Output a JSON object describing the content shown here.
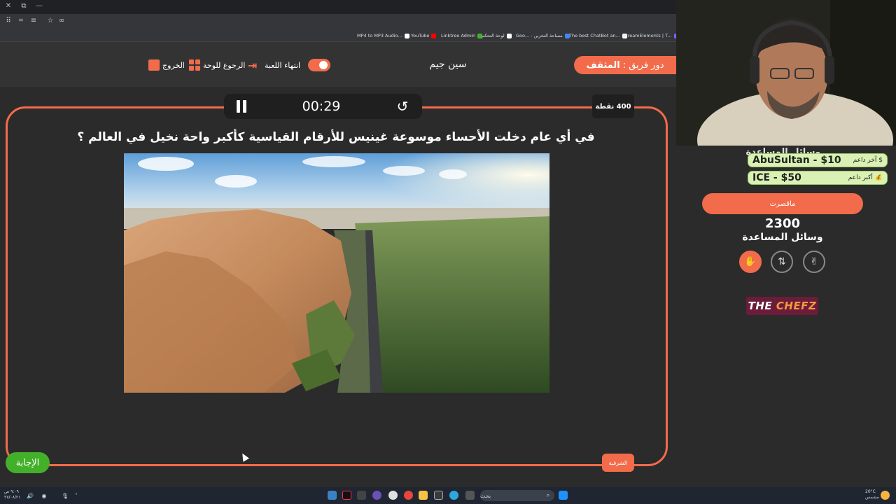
{
  "browser": {
    "bookmarks": [
      {
        "label": "MP4 to MP3 Audio...",
        "color": "#e53935"
      },
      {
        "label": "YouTube",
        "color": "#ff0000"
      },
      {
        "label": "Linktree Admin",
        "color": "#43b02a"
      },
      {
        "label": "لوحة التحكم",
        "color": "#ffffff"
      },
      {
        "label": "Goo... - مساحة التخزين",
        "color": "#4285f4"
      },
      {
        "label": "The best ChatBot an...",
        "color": "#ffffff"
      },
      {
        "label": "StreamElements | T...",
        "color": "#7b61ff"
      }
    ]
  },
  "header": {
    "team_label": "دور فريق :",
    "team_name": "المثقف",
    "player": "سين جيم",
    "end_game": "انتهاء اللعبة",
    "back_to_board": "الرجوع للوحة",
    "exit": "الخروج"
  },
  "game": {
    "timer": "00:29",
    "points": "400 نقطة",
    "question": "في أي عام دخلت الأحساء موسوعة غينيس للأرقام القياسية كأكبر واحة نخيل في العالم ؟",
    "answer_button": "الإجابة",
    "region_button": "الشرقية"
  },
  "sidebar": {
    "aids_title_top": "وسائل المساعدة",
    "donors": [
      {
        "amount": "AbuSultan - $10",
        "label": "$ آخر داعم"
      },
      {
        "amount": "ICE - $50",
        "label": "💰 أكبر داعم"
      }
    ],
    "team_button": "ماقصرت",
    "score": "2300",
    "aids_title": "وسائل المساعدة",
    "aids": [
      "hand-icon",
      "swap-icon",
      "two-fingers-icon"
    ],
    "logo_left": "THE",
    "logo_right": "CHEFZ"
  },
  "taskbar": {
    "search": "بحث",
    "time": "٩:٠٩ ص",
    "date": "٢٧/٠٨/٢١",
    "weather_temp": "20°C",
    "weather_desc": "مشمس"
  },
  "colors": {
    "accent": "#f26b4b",
    "answer": "#43b02a",
    "logo_bg": "#6b1c3a"
  }
}
